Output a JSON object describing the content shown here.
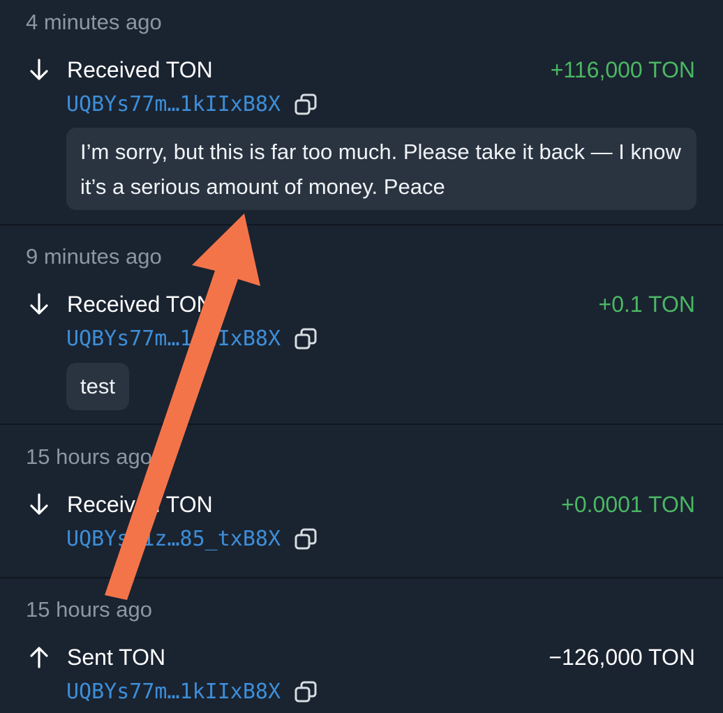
{
  "colors": {
    "background": "#1a2330",
    "positive_amount": "#4bb863",
    "address_link": "#3d8ed8",
    "comment_bubble": "#2a3441",
    "timestamp": "#8b97a3",
    "annotation_arrow": "#f4744a"
  },
  "transactions": [
    {
      "time": "4 minutes ago",
      "direction_icon": "arrow-down-icon",
      "title": "Received TON",
      "amount": "+116,000 TON",
      "address": "UQBYs77m…1kIIxB8X",
      "comment": "I’m sorry, but this is far too much. Please take it back — I know it’s a serious amount of money. Peace"
    },
    {
      "time": "9 minutes ago",
      "direction_icon": "arrow-down-icon",
      "title": "Received TON",
      "amount": "+0.1 TON",
      "address": "UQBYs77m…1kIIxB8X",
      "comment": "test"
    },
    {
      "time": "15 hours ago",
      "direction_icon": "arrow-down-icon",
      "title": "Received TON",
      "amount": "+0.0001 TON",
      "address": "UQBYsp1z…85_txB8X"
    },
    {
      "time": "15 hours ago",
      "direction_icon": "arrow-up-icon",
      "title": "Sent TON",
      "amount": "−126,000 TON",
      "address": "UQBYs77m…1kIIxB8X"
    }
  ],
  "copy_icon": "copy-icon",
  "annotation": "arrow-annotation-icon"
}
